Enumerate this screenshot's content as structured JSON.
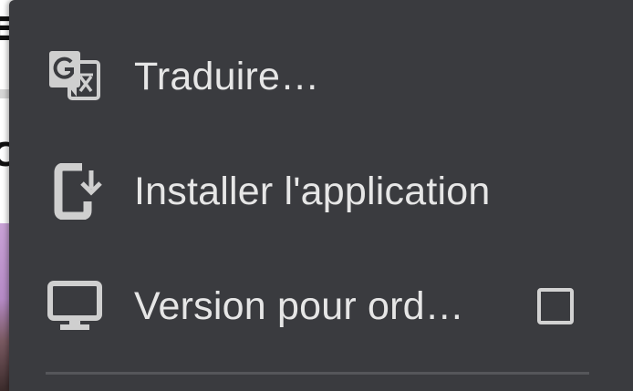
{
  "background_page": {
    "letter_top": "E",
    "letter_mid": "C"
  },
  "menu": {
    "items": [
      {
        "label": "Traduire…",
        "icon": "google-translate-icon"
      },
      {
        "label": "Installer l'application",
        "icon": "install-app-icon"
      },
      {
        "label": "Version pour ord…",
        "icon": "desktop-monitor-icon",
        "checkbox_checked": false
      }
    ]
  },
  "colors": {
    "menu_background": "#3a3b3f",
    "menu_text": "#e6e6e6",
    "icon": "#cfcfcf",
    "divider": "#55565a"
  }
}
